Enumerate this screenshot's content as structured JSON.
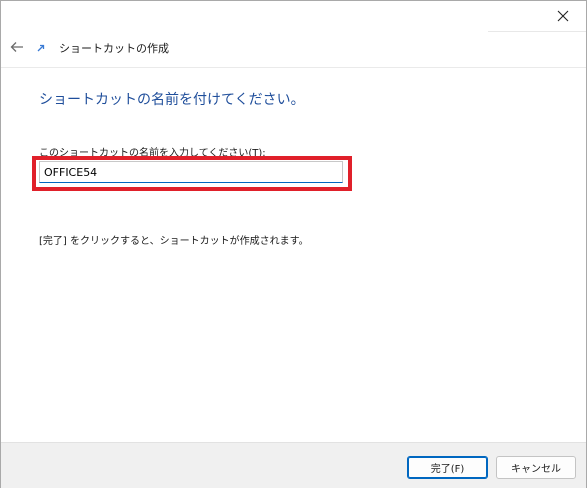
{
  "window": {
    "close_icon": "close-icon"
  },
  "nav": {
    "back_icon": "back-arrow-icon",
    "wizard_icon": "shortcut-arrow-icon",
    "title": "ショートカットの作成"
  },
  "content": {
    "heading": "ショートカットの名前を付けてください。",
    "field_label": "このショートカットの名前を入力してください(T):",
    "name_value": "OFFICE54",
    "info_text": "[完了] をクリックすると、ショートカットが作成されます。"
  },
  "footer": {
    "finish_label": "完了(F)",
    "cancel_label": "キャンセル"
  },
  "colors": {
    "heading": "#1f4e9b",
    "highlight": "#e0202a",
    "accent": "#0067c0"
  }
}
